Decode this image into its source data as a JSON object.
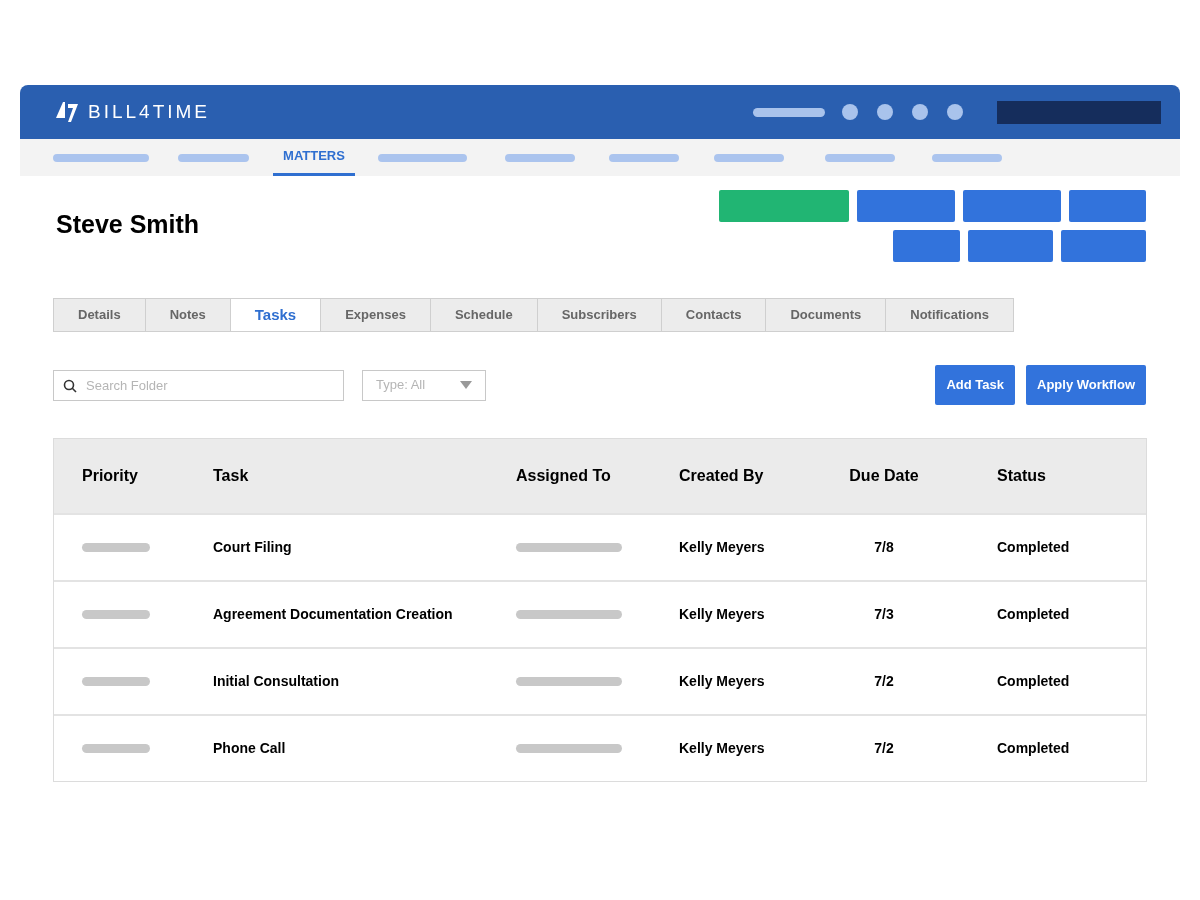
{
  "app": {
    "logo_text": "BILL4TIME"
  },
  "nav": [
    {
      "kind": "placeholder",
      "selected": false
    },
    {
      "kind": "placeholder",
      "selected": false
    },
    {
      "kind": "label",
      "label": "MATTERS",
      "selected": true
    },
    {
      "kind": "placeholder",
      "selected": false
    },
    {
      "kind": "placeholder",
      "selected": false
    },
    {
      "kind": "placeholder",
      "selected": false
    },
    {
      "kind": "placeholder",
      "selected": false
    },
    {
      "kind": "placeholder",
      "selected": false
    },
    {
      "kind": "placeholder",
      "selected": false
    }
  ],
  "matter": {
    "client_name": "Steve Smith"
  },
  "action_blocks": [
    {
      "color": "#21b573"
    },
    {
      "color": "#3273dc"
    },
    {
      "color": "#3273dc"
    },
    {
      "color": "#3273dc"
    },
    {
      "color": "#3273dc"
    },
    {
      "color": "#3273dc"
    },
    {
      "color": "#3273dc"
    }
  ],
  "tabs": [
    {
      "label": "Details",
      "selected": false
    },
    {
      "label": "Notes",
      "selected": false
    },
    {
      "label": "Tasks",
      "selected": true
    },
    {
      "label": "Expenses",
      "selected": false
    },
    {
      "label": "Schedule",
      "selected": false
    },
    {
      "label": "Subscribers",
      "selected": false
    },
    {
      "label": "Contacts",
      "selected": false
    },
    {
      "label": "Documents",
      "selected": false
    },
    {
      "label": "Notifications",
      "selected": false
    }
  ],
  "search": {
    "placeholder": "Search Folder"
  },
  "type_filter": {
    "value": "Type: All"
  },
  "buttons": [
    "Add Task",
    "Apply Workflow"
  ],
  "table": {
    "columns": [
      "Priority",
      "Task",
      "Assigned To",
      "Created By",
      "Due Date",
      "Status"
    ],
    "rows": [
      {
        "task": "Court Filing",
        "created_by": "Kelly Meyers",
        "due_date": "7/8",
        "status": "Completed"
      },
      {
        "task": "Agreement Documentation Creation",
        "created_by": "Kelly Meyers",
        "due_date": "7/3",
        "status": "Completed"
      },
      {
        "task": "Initial Consultation",
        "created_by": "Kelly Meyers",
        "due_date": "7/2",
        "status": "Completed"
      },
      {
        "task": "Phone Call",
        "created_by": "Kelly Meyers",
        "due_date": "7/2",
        "status": "Completed"
      }
    ]
  }
}
